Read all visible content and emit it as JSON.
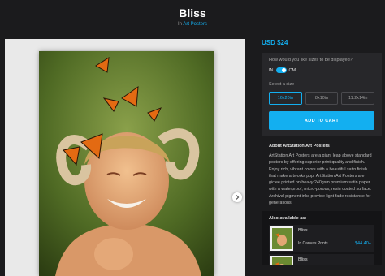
{
  "page": {
    "title": "Bliss",
    "subtitle_prefix": "In",
    "subtitle_link": "Art Posters"
  },
  "product": {
    "price": "USD $24",
    "size_question": "How would you like sizes to be displayed?",
    "unit_in": "IN",
    "unit_cm": "CM",
    "select_size_label": "Select a size",
    "sizes": [
      "16x20in",
      "8x10in",
      "11.2x14in"
    ],
    "selected_size": "16x20in",
    "add_to_cart": "ADD TO CART"
  },
  "about": {
    "title": "About ArtStation Art Posters",
    "text": "ArtStation Art Posters are a giant leap above standard posters by offering superior print quality and finish. Enjoy rich, vibrant colors with a beautiful satin finish that make artworks pop. ArtStation Art Posters are giclee printed on heavy 240gsm premium satin paper with a waterproof, micro-porous, resin coated surface. Archival pigment inks provide light-fade resistance for generations."
  },
  "also_available": {
    "title": "Also available as:",
    "items": [
      {
        "name": "Bliss",
        "type": "In Canvas Prints",
        "price": "$44.40+"
      },
      {
        "name": "Bliss",
        "type": "",
        "price": ""
      }
    ]
  },
  "colors": {
    "accent": "#13aff0",
    "background": "#1b1b1d",
    "panel": "#27272a"
  }
}
